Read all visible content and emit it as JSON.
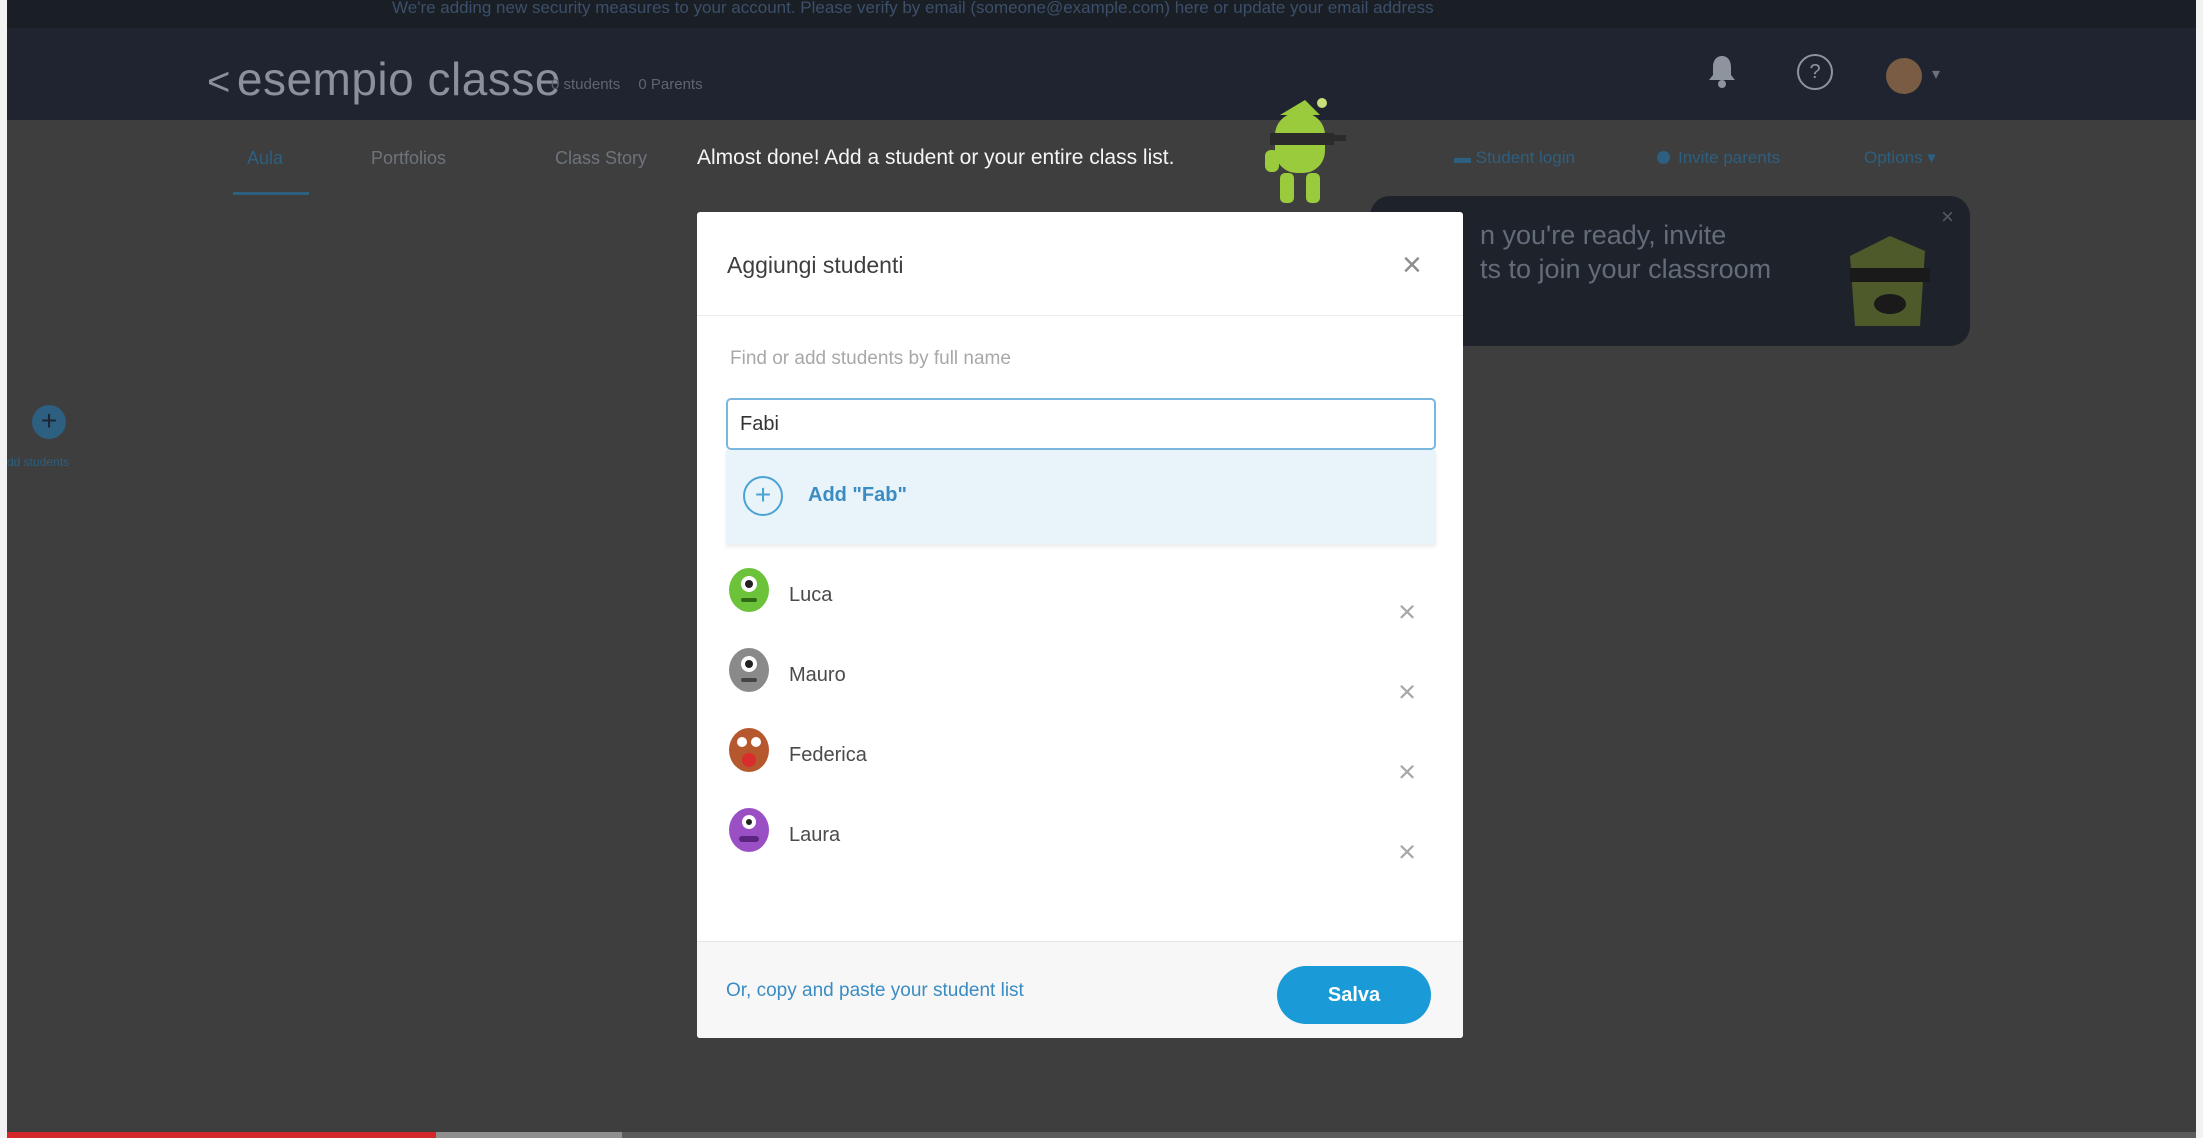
{
  "banner": {
    "text": "We're adding new security measures to your account. Please verify by email (someone@example.com) here or update your email address"
  },
  "header": {
    "back_chevron": "<",
    "class_name": "esempio classe",
    "students_count": "0 students",
    "parents_count": "0 Parents",
    "bell_icon": "bell-icon",
    "help_icon": "help-icon",
    "avatar_caret": "▾"
  },
  "tabs": [
    {
      "label": "Aula",
      "active": true
    },
    {
      "label": "Portfolios",
      "active": false
    },
    {
      "label": "Class Story",
      "active": false
    }
  ],
  "hint_text": "Almost done! Add a student or your entire class list.",
  "right_links": {
    "student_login": "Student login",
    "invite_parents": "Invite parents",
    "options": "Options ▾"
  },
  "tooltip": {
    "line1": "n you're ready, invite",
    "line2": "ts to join your classroom",
    "close": "×"
  },
  "side": {
    "add_label": "dd students"
  },
  "modal": {
    "title": "Aggiungi studenti",
    "close_symbol": "×",
    "find_label": "Find or add students by full name",
    "search_value": "Fabi",
    "suggestion": "Add \"Fab\"",
    "students": [
      {
        "name": "Luca",
        "color": "#6cc33a"
      },
      {
        "name": "Mauro",
        "color": "#8a8a8a"
      },
      {
        "name": "Federica",
        "color": "#b5582e"
      },
      {
        "name": "Laura",
        "color": "#9b4fc4"
      }
    ],
    "paste_link": "Or, copy and paste your student list",
    "save_label": "Salva"
  },
  "colors": {
    "accent": "#1a9ad6",
    "topbar": "#1f2430",
    "progress": "#d4272a"
  },
  "video_progress": {
    "played_fraction": 0.196,
    "buffered_fraction": 0.085
  }
}
